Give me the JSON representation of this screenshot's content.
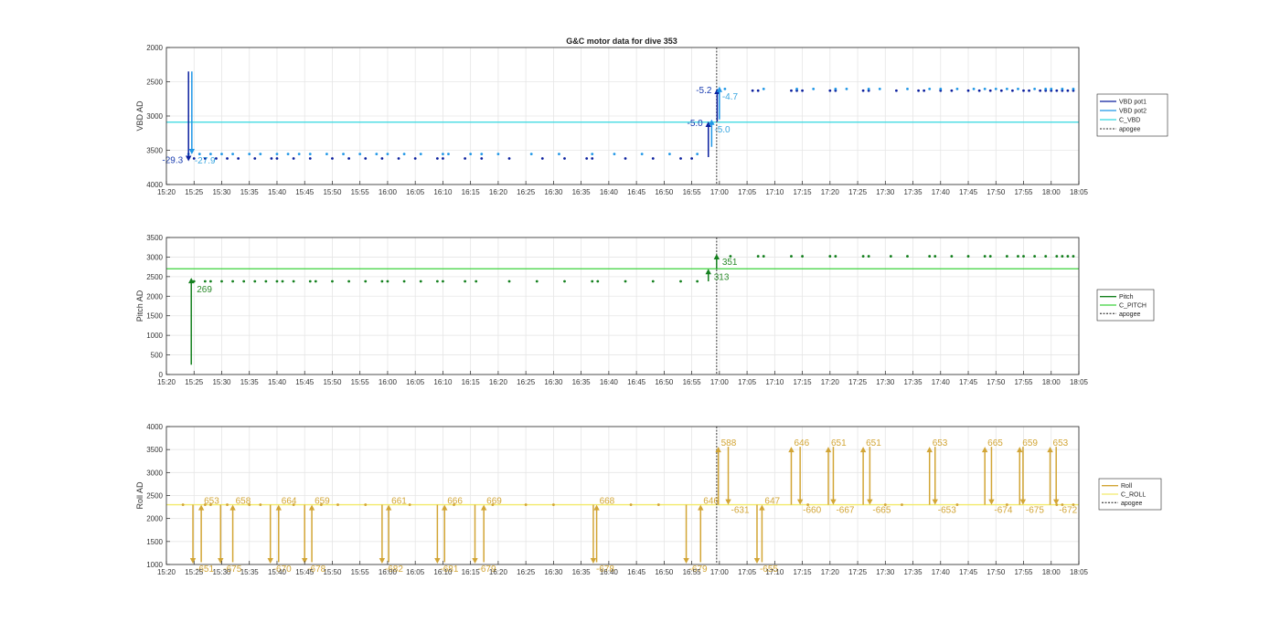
{
  "figure_title": "G&C motor data for dive 353",
  "colors": {
    "vbd_pot1": "#0a1f9e",
    "vbd_pot2": "#1e96e6",
    "c_vbd": "#31d7e0",
    "pitch": "#14801e",
    "c_pitch": "#3cd23c",
    "roll": "#d2a535",
    "c_roll": "#f2ea6a",
    "apogee": "#555555",
    "grid": "#e6e6e6"
  },
  "chart_data": [
    {
      "type": "scatter",
      "ylabel": "VBD AD",
      "y_reversed": true,
      "ylim": [
        2000,
        4000
      ],
      "yticks": [
        2000,
        2500,
        3000,
        3500,
        4000
      ],
      "xlim": [
        "15:20",
        "18:05"
      ],
      "xticks": [
        "15:20",
        "15:25",
        "15:30",
        "15:35",
        "15:40",
        "15:45",
        "15:50",
        "15:55",
        "16:00",
        "16:05",
        "16:10",
        "16:15",
        "16:20",
        "16:25",
        "16:30",
        "16:35",
        "16:40",
        "16:45",
        "16:50",
        "16:55",
        "17:00",
        "17:05",
        "17:10",
        "17:15",
        "17:20",
        "17:25",
        "17:30",
        "17:35",
        "17:40",
        "17:45",
        "17:50",
        "17:55",
        "18:00",
        "18:05"
      ],
      "grid": true,
      "legend": {
        "placement": "right",
        "entries": [
          "VBD pot1",
          "VBD pot2",
          "C_VBD",
          "apogee"
        ]
      },
      "apogee_time": "16:59.5",
      "series": [
        {
          "name": "VBD pot1",
          "color_key": "vbd_pot1",
          "dot_times": [
            "15:25",
            "15:27",
            "15:29",
            "15:31",
            "15:33",
            "15:36",
            "15:39",
            "15:40",
            "15:43",
            "15:46",
            "15:50",
            "15:53",
            "15:56",
            "15:59",
            "16:02",
            "16:05",
            "16:09",
            "16:10",
            "16:14",
            "16:17",
            "16:22",
            "16:28",
            "16:32",
            "16:36",
            "16:37",
            "16:43",
            "16:48",
            "16:53",
            "16:55"
          ],
          "dot_value": 3620,
          "late_dot_times": [
            "17:06",
            "17:07",
            "17:13",
            "17:14",
            "17:15",
            "17:20",
            "17:21",
            "17:26",
            "17:27",
            "17:32",
            "17:36",
            "17:37",
            "17:40",
            "17:42",
            "17:45",
            "17:47",
            "17:49",
            "17:51",
            "17:53",
            "17:55",
            "17:56",
            "17:58",
            "17:59",
            "18:00",
            "18:01",
            "18:02",
            "18:03",
            "18:04"
          ],
          "late_dot_value": 2630
        },
        {
          "name": "VBD pot2",
          "color_key": "vbd_pot2",
          "dot_times": [
            "15:24",
            "15:26",
            "15:28",
            "15:30",
            "15:32",
            "15:35",
            "15:37",
            "15:40",
            "15:42",
            "15:44",
            "15:46",
            "15:49",
            "15:52",
            "15:55",
            "15:58",
            "16:00",
            "16:03",
            "16:06",
            "16:10",
            "16:11",
            "16:15",
            "16:17",
            "16:20",
            "16:26",
            "16:31",
            "16:37",
            "16:41",
            "16:46",
            "16:51",
            "16:56"
          ],
          "dot_value": 3555,
          "late_dot_times": [
            "17:01",
            "17:08",
            "17:14",
            "17:17",
            "17:21",
            "17:23",
            "17:27",
            "17:29",
            "17:34",
            "17:38",
            "17:40",
            "17:43",
            "17:46",
            "17:48",
            "17:50",
            "17:52",
            "17:54",
            "17:57",
            "17:59",
            "18:00",
            "18:02",
            "18:04"
          ],
          "late_dot_value": 2605
        },
        {
          "name": "C_VBD",
          "color_key": "c_vbd",
          "constant": 3090
        }
      ],
      "events": [
        {
          "start_time": "15:24.0",
          "from": 2350,
          "to": 3660,
          "color_key": "vbd_pot1",
          "label": "-29.3",
          "label_color": "#1a3db0"
        },
        {
          "start_time": "15:24.6",
          "from": 2350,
          "to": 3560,
          "color_key": "vbd_pot2",
          "label": "-27.9",
          "label_color": "#3aa6e0"
        },
        {
          "start_time": "16:58.0",
          "from": 3600,
          "to": 3080,
          "color_key": "vbd_pot1",
          "label": "-5.0",
          "label_color": "#1a3db0"
        },
        {
          "start_time": "16:58.6",
          "from": 3450,
          "to": 3050,
          "color_key": "vbd_pot2",
          "label": "-5.0",
          "label_color": "#3aa6e0"
        },
        {
          "start_time": "16:59.6",
          "from": 3080,
          "to": 2600,
          "color_key": "vbd_pot1",
          "label": "-5.2",
          "label_color": "#1a3db0"
        },
        {
          "start_time": "17:00.0",
          "from": 3050,
          "to": 2570,
          "color_key": "vbd_pot2",
          "label": "-4.7",
          "label_color": "#3aa6e0"
        }
      ]
    },
    {
      "type": "scatter",
      "ylabel": "Pitch AD",
      "ylim": [
        0,
        3500
      ],
      "yticks": [
        0,
        500,
        1000,
        1500,
        2000,
        2500,
        3000,
        3500
      ],
      "xlim": [
        "15:20",
        "18:05"
      ],
      "xticks": [
        "15:20",
        "15:25",
        "15:30",
        "15:35",
        "15:40",
        "15:45",
        "15:50",
        "15:55",
        "16:00",
        "16:05",
        "16:10",
        "16:15",
        "16:20",
        "16:25",
        "16:30",
        "16:35",
        "16:40",
        "16:45",
        "16:50",
        "16:55",
        "17:00",
        "17:05",
        "17:10",
        "17:15",
        "17:20",
        "17:25",
        "17:30",
        "17:35",
        "17:40",
        "17:45",
        "17:50",
        "17:55",
        "18:00",
        "18:05"
      ],
      "grid": true,
      "legend": {
        "placement": "right",
        "entries": [
          "Pitch",
          "C_PITCH",
          "apogee"
        ]
      },
      "apogee_time": "16:59.5",
      "series": [
        {
          "name": "Pitch",
          "color_key": "pitch",
          "dot_times": [
            "15:25",
            "15:27",
            "15:28",
            "15:30",
            "15:32",
            "15:34",
            "15:36",
            "15:38",
            "15:40",
            "15:41",
            "15:43",
            "15:46",
            "15:47",
            "15:50",
            "15:53",
            "15:56",
            "15:59",
            "16:00",
            "16:03",
            "16:06",
            "16:09",
            "16:10",
            "16:14",
            "16:16",
            "16:22",
            "16:27",
            "16:32",
            "16:37",
            "16:38",
            "16:43",
            "16:48",
            "16:53",
            "16:56"
          ],
          "dot_value": 2380,
          "late_dot_times": [
            "17:02",
            "17:07",
            "17:08",
            "17:13",
            "17:15",
            "17:20",
            "17:21",
            "17:26",
            "17:27",
            "17:31",
            "17:34",
            "17:38",
            "17:39",
            "17:42",
            "17:45",
            "17:48",
            "17:49",
            "17:52",
            "17:54",
            "17:55",
            "17:57",
            "17:59",
            "18:01",
            "18:02",
            "18:03",
            "18:04"
          ],
          "late_dot_value": 3020
        },
        {
          "name": "C_PITCH",
          "color_key": "c_pitch",
          "constant": 2700
        }
      ],
      "events": [
        {
          "start_time": "15:24.5",
          "from": 250,
          "to": 2470,
          "color_key": "pitch",
          "label": "269",
          "label_color": "#2a8a2a"
        },
        {
          "start_time": "16:58.0",
          "from": 2380,
          "to": 2700,
          "color_key": "pitch",
          "label": "313",
          "label_color": "#2a8a2a"
        },
        {
          "start_time": "16:59.5",
          "from": 2700,
          "to": 3080,
          "color_key": "pitch",
          "label": "351",
          "label_color": "#2a8a2a"
        }
      ]
    },
    {
      "type": "scatter",
      "ylabel": "Roll AD",
      "ylim": [
        1000,
        4000
      ],
      "yticks": [
        1000,
        1500,
        2000,
        2500,
        3000,
        3500,
        4000
      ],
      "xlim": [
        "15:20",
        "18:05"
      ],
      "xticks": [
        "15:20",
        "15:25",
        "15:30",
        "15:35",
        "15:40",
        "15:45",
        "15:50",
        "15:55",
        "16:00",
        "16:05",
        "16:10",
        "16:15",
        "16:20",
        "16:25",
        "16:30",
        "16:35",
        "16:40",
        "16:45",
        "16:50",
        "16:55",
        "17:00",
        "17:05",
        "17:10",
        "17:15",
        "17:20",
        "17:25",
        "17:30",
        "17:35",
        "17:40",
        "17:45",
        "17:50",
        "17:55",
        "18:00",
        "18:05"
      ],
      "grid": true,
      "legend": {
        "placement": "right",
        "entries": [
          "Roll",
          "C_ROLL",
          "apogee"
        ]
      },
      "apogee_time": "16:59.5",
      "series": [
        {
          "name": "Roll",
          "color_key": "roll",
          "dot_times": [
            "15:23",
            "15:27",
            "15:28",
            "15:31",
            "15:35",
            "15:37",
            "15:43",
            "15:48",
            "15:51",
            "15:56",
            "16:04",
            "16:12",
            "16:19",
            "16:25",
            "16:30",
            "16:44",
            "16:49",
            "17:16",
            "17:30",
            "17:33",
            "17:43",
            "17:52",
            "18:01",
            "18:02",
            "18:04"
          ],
          "dot_value": 2300
        },
        {
          "name": "C_ROLL",
          "color_key": "c_roll",
          "constant": 2300
        }
      ],
      "events": [
        {
          "start_time": "15:24.8",
          "from": 2300,
          "to": 1020,
          "color_key": "roll",
          "label": "-651"
        },
        {
          "start_time": "15:26.3",
          "from": 1050,
          "to": 2300,
          "color_key": "roll",
          "label": "653"
        },
        {
          "start_time": "15:29.8",
          "from": 2300,
          "to": 1020,
          "color_key": "roll",
          "label": "-675"
        },
        {
          "start_time": "15:32.0",
          "from": 1050,
          "to": 2300,
          "color_key": "roll",
          "label": "658"
        },
        {
          "start_time": "15:38.8",
          "from": 2300,
          "to": 1020,
          "color_key": "roll",
          "label": "-670"
        },
        {
          "start_time": "15:40.3",
          "from": 1050,
          "to": 2300,
          "color_key": "roll",
          "label": "664"
        },
        {
          "start_time": "15:45.0",
          "from": 2300,
          "to": 1020,
          "color_key": "roll",
          "label": "-678"
        },
        {
          "start_time": "15:46.3",
          "from": 1050,
          "to": 2300,
          "color_key": "roll",
          "label": "659"
        },
        {
          "start_time": "15:59.0",
          "from": 2300,
          "to": 1020,
          "color_key": "roll",
          "label": "-682"
        },
        {
          "start_time": "16:00.2",
          "from": 1050,
          "to": 2300,
          "color_key": "roll",
          "label": "661"
        },
        {
          "start_time": "16:09.0",
          "from": 2300,
          "to": 1020,
          "color_key": "roll",
          "label": "-681"
        },
        {
          "start_time": "16:10.3",
          "from": 1050,
          "to": 2300,
          "color_key": "roll",
          "label": "666"
        },
        {
          "start_time": "16:15.8",
          "from": 2300,
          "to": 1020,
          "color_key": "roll",
          "label": "-679"
        },
        {
          "start_time": "16:17.4",
          "from": 1050,
          "to": 2300,
          "color_key": "roll",
          "label": "669"
        },
        {
          "start_time": "16:37.2",
          "from": 2300,
          "to": 1020,
          "color_key": "roll",
          "label": "-678"
        },
        {
          "start_time": "16:37.8",
          "from": 1050,
          "to": 2300,
          "color_key": "roll",
          "label": "668"
        },
        {
          "start_time": "16:54.0",
          "from": 2300,
          "to": 1020,
          "color_key": "roll",
          "label": "-679"
        },
        {
          "start_time": "16:56.6",
          "from": 1050,
          "to": 2300,
          "color_key": "roll",
          "label": "646"
        },
        {
          "start_time": "16:59.8",
          "from": 2300,
          "to": 3560,
          "color_key": "roll",
          "label": "588"
        },
        {
          "start_time": "17:01.6",
          "from": 3560,
          "to": 2300,
          "color_key": "roll",
          "label": "-631"
        },
        {
          "start_time": "17:06.8",
          "from": 2300,
          "to": 1020,
          "color_key": "roll",
          "label": "-655"
        },
        {
          "start_time": "17:07.7",
          "from": 1050,
          "to": 2300,
          "color_key": "roll",
          "label": "647"
        },
        {
          "start_time": "17:13.0",
          "from": 2300,
          "to": 3560,
          "color_key": "roll",
          "label": "646"
        },
        {
          "start_time": "17:14.6",
          "from": 3560,
          "to": 2300,
          "color_key": "roll",
          "label": "-660"
        },
        {
          "start_time": "17:19.7",
          "from": 2300,
          "to": 3560,
          "color_key": "roll",
          "label": "651"
        },
        {
          "start_time": "17:20.6",
          "from": 3560,
          "to": 2300,
          "color_key": "roll",
          "label": "-667"
        },
        {
          "start_time": "17:26.0",
          "from": 2300,
          "to": 3560,
          "color_key": "roll",
          "label": "651"
        },
        {
          "start_time": "17:27.2",
          "from": 3560,
          "to": 2300,
          "color_key": "roll",
          "label": "-665"
        },
        {
          "start_time": "17:38.0",
          "from": 2300,
          "to": 3560,
          "color_key": "roll",
          "label": "653"
        },
        {
          "start_time": "17:39.0",
          "from": 3560,
          "to": 2300,
          "color_key": "roll",
          "label": "-653"
        },
        {
          "start_time": "17:48.0",
          "from": 2300,
          "to": 3560,
          "color_key": "roll",
          "label": "665"
        },
        {
          "start_time": "17:49.2",
          "from": 3560,
          "to": 2300,
          "color_key": "roll",
          "label": "-674"
        },
        {
          "start_time": "17:54.3",
          "from": 2300,
          "to": 3560,
          "color_key": "roll",
          "label": "659"
        },
        {
          "start_time": "17:54.9",
          "from": 3560,
          "to": 2300,
          "color_key": "roll",
          "label": "-675"
        },
        {
          "start_time": "17:59.8",
          "from": 2300,
          "to": 3560,
          "color_key": "roll",
          "label": "653"
        },
        {
          "start_time": "18:00.9",
          "from": 3560,
          "to": 2300,
          "color_key": "roll",
          "label": "-672"
        }
      ]
    }
  ]
}
